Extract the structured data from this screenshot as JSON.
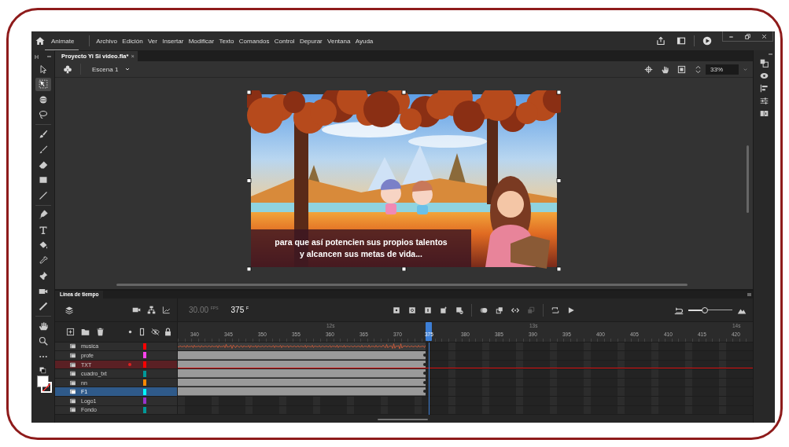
{
  "app": {
    "name": "Animate",
    "menu": [
      "Archivo",
      "Edición",
      "Ver",
      "Insertar",
      "Modificar",
      "Texto",
      "Comandos",
      "Control",
      "Depurar",
      "Ventana",
      "Ayuda"
    ]
  },
  "tools_panel": {
    "label": "H",
    "tools": [
      {
        "kind": "select",
        "selected": false
      },
      {
        "kind": "transform",
        "selected": true
      },
      {
        "kind": "sphere",
        "selected": false
      },
      {
        "kind": "lasso",
        "selected": false
      },
      {
        "kind": "paintbrush",
        "selected": false
      },
      {
        "kind": "brush",
        "selected": false
      },
      {
        "kind": "eraser",
        "selected": false
      },
      {
        "kind": "rect",
        "selected": false
      },
      {
        "kind": "line",
        "selected": false
      },
      {
        "kind": "pen",
        "selected": false
      },
      {
        "kind": "text",
        "selected": false
      },
      {
        "kind": "bucket",
        "selected": false
      },
      {
        "kind": "dropper",
        "selected": false
      },
      {
        "kind": "pin",
        "selected": false
      },
      {
        "kind": "camera",
        "selected": false
      },
      {
        "kind": "bone",
        "selected": false
      },
      {
        "kind": "hand",
        "selected": false
      },
      {
        "kind": "zoom",
        "selected": false
      },
      {
        "kind": "more",
        "selected": false
      }
    ]
  },
  "document_tab": {
    "title": "Proyecto Yi Si video.fla*",
    "close": "×"
  },
  "scene_bar": {
    "scene": "Escena 1",
    "zoom": "33%"
  },
  "stage": {
    "caption": [
      "para que así potencien sus propios talentos",
      "y alcancen sus metas de vida..."
    ]
  },
  "timeline": {
    "tab": "Línea de tiempo",
    "fps": "30.00",
    "fps_unit": "FPS",
    "frame": "375",
    "frame_unit": "F",
    "buttons": [
      {
        "kind": "keyframe",
        "disabled": false
      },
      {
        "kind": "blank",
        "disabled": false
      },
      {
        "kind": "split",
        "disabled": false
      },
      {
        "kind": "tween",
        "disabled": false
      },
      {
        "kind": "remove",
        "disabled": false
      },
      {
        "kind": "onion",
        "disabled": false
      },
      {
        "kind": "copy",
        "disabled": false
      },
      {
        "kind": "code",
        "disabled": false
      },
      {
        "kind": "paste",
        "disabled": true
      },
      {
        "kind": "loop",
        "disabled": false
      },
      {
        "kind": "play",
        "disabled": false
      }
    ],
    "zoom": {
      "level": 0.38
    },
    "ruler_frames": [
      "340",
      "345",
      "350",
      "355",
      "360",
      "365",
      "370",
      "375",
      "380",
      "385",
      "390",
      "395",
      "400",
      "405",
      "410",
      "415",
      "420"
    ],
    "ruler_seconds": [
      "12s",
      "13s",
      "14s"
    ],
    "layers": [
      {
        "name": "musica",
        "color": "#ff0000",
        "kind": "audio",
        "selected": false,
        "active": false
      },
      {
        "name": "profe",
        "color": "#ff44ee",
        "kind": "frames",
        "selected": false,
        "active": false
      },
      {
        "name": "TXT",
        "color": "#ff0000",
        "kind": "frames",
        "selected": false,
        "active": true
      },
      {
        "name": "cuadro_txt",
        "color": "#009999",
        "kind": "frames",
        "selected": false,
        "active": false
      },
      {
        "name": "nn",
        "color": "#ff8800",
        "kind": "frames",
        "selected": false,
        "active": false
      },
      {
        "name": "F1",
        "color": "#00ffff",
        "kind": "frames",
        "selected": true,
        "active": false
      },
      {
        "name": "Logo1",
        "color": "#9933cc",
        "kind": "empty",
        "selected": false,
        "active": false
      },
      {
        "name": "Fondo",
        "color": "#009999",
        "kind": "empty",
        "selected": false,
        "active": false
      }
    ]
  }
}
